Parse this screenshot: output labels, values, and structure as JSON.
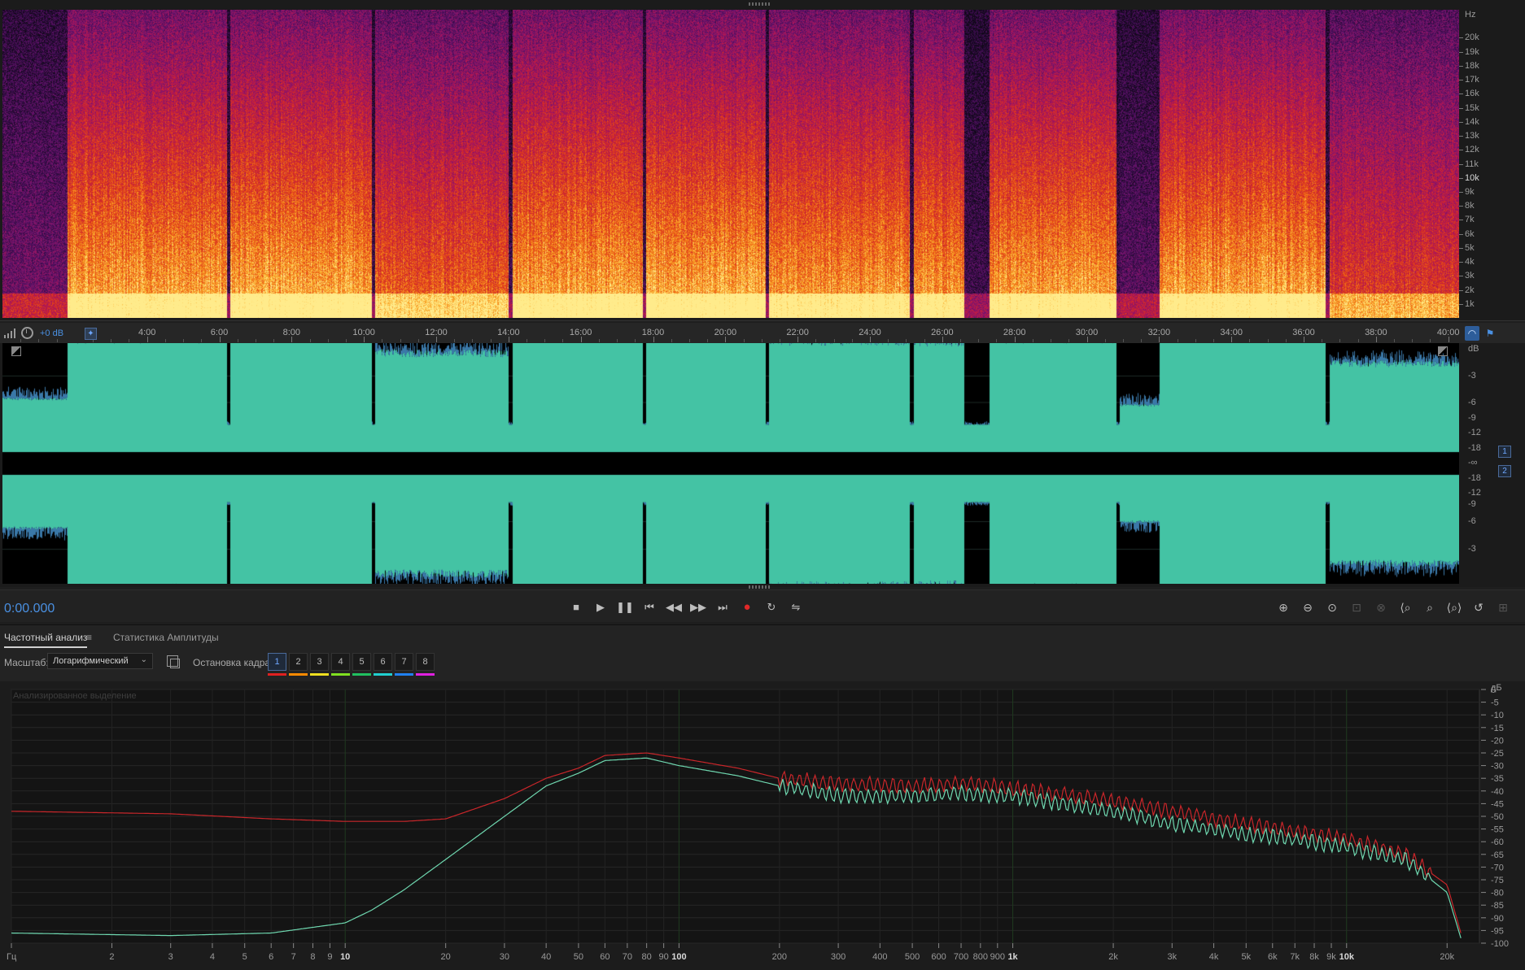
{
  "spectrogram": {
    "unit": "Hz",
    "freq_labels": [
      {
        "label": "20k",
        "hz": 20000
      },
      {
        "label": "19k",
        "hz": 19000
      },
      {
        "label": "18k",
        "hz": 18000
      },
      {
        "label": "17k",
        "hz": 17000
      },
      {
        "label": "16k",
        "hz": 16000
      },
      {
        "label": "15k",
        "hz": 15000
      },
      {
        "label": "14k",
        "hz": 14000
      },
      {
        "label": "13k",
        "hz": 13000
      },
      {
        "label": "12k",
        "hz": 12000
      },
      {
        "label": "11k",
        "hz": 11000
      },
      {
        "label": "10k",
        "hz": 10000
      },
      {
        "label": "9k",
        "hz": 9000
      },
      {
        "label": "8k",
        "hz": 8000
      },
      {
        "label": "7k",
        "hz": 7000
      },
      {
        "label": "6k",
        "hz": 6000
      },
      {
        "label": "5k",
        "hz": 5000
      },
      {
        "label": "4k",
        "hz": 4000
      },
      {
        "label": "3k",
        "hz": 3000
      },
      {
        "label": "2k",
        "hz": 2000
      },
      {
        "label": "1k",
        "hz": 1000
      }
    ],
    "max_hz": 22000
  },
  "timeline": {
    "gain": "+0 dB",
    "total_minutes": 40.3,
    "labels": [
      "4:00",
      "6:00",
      "8:00",
      "10:00",
      "12:00",
      "14:00",
      "16:00",
      "18:00",
      "20:00",
      "22:00",
      "24:00",
      "26:00",
      "28:00",
      "30:00",
      "32:00",
      "34:00",
      "36:00",
      "38:00",
      "40:00"
    ],
    "segments": [
      {
        "start": 0.0,
        "end": 1.8,
        "level": 0.28
      },
      {
        "start": 1.8,
        "end": 6.2,
        "level": 0.86
      },
      {
        "start": 6.3,
        "end": 10.2,
        "level": 0.88
      },
      {
        "start": 10.3,
        "end": 14.0,
        "level": 0.72
      },
      {
        "start": 14.1,
        "end": 17.7,
        "level": 0.87
      },
      {
        "start": 17.8,
        "end": 21.1,
        "level": 0.88
      },
      {
        "start": 21.2,
        "end": 25.1,
        "level": 0.84
      },
      {
        "start": 25.2,
        "end": 26.6,
        "level": 0.83
      },
      {
        "start": 27.3,
        "end": 30.8,
        "level": 0.86
      },
      {
        "start": 30.9,
        "end": 32.0,
        "level": 0.22
      },
      {
        "start": 32.0,
        "end": 36.6,
        "level": 0.87
      },
      {
        "start": 36.7,
        "end": 40.3,
        "level": 0.62
      }
    ]
  },
  "waveform": {
    "db_labels": [
      {
        "label": "dB",
        "pos": 0.025
      },
      {
        "label": "-3",
        "pos": 0.135
      },
      {
        "label": "-6",
        "pos": 0.245
      },
      {
        "label": "-9",
        "pos": 0.31
      },
      {
        "label": "-12",
        "pos": 0.37
      },
      {
        "label": "-18",
        "pos": 0.435
      },
      {
        "label": "-∞",
        "pos": 0.495
      },
      {
        "label": "-18",
        "pos": 0.56
      },
      {
        "label": "-12",
        "pos": 0.62
      },
      {
        "label": "-9",
        "pos": 0.67
      },
      {
        "label": "-6",
        "pos": 0.74
      },
      {
        "label": "-3",
        "pos": 0.855
      }
    ],
    "channels": [
      "1",
      "2"
    ]
  },
  "transport": {
    "time": "0:00.000",
    "buttons": [
      "stop-icon",
      "play-icon",
      "pause-icon",
      "go-to-start-icon",
      "rewind-icon",
      "fast-forward-icon",
      "go-to-end-icon",
      "record-icon",
      "loop-icon",
      "skip-selection-icon"
    ],
    "zoom_buttons": [
      "zoom-in-amplitude-icon",
      "zoom-out-amplitude-icon",
      "zoom-reset-icon",
      "zoom-selection-icon",
      "zoom-left-icon",
      "zoom-in-time-icon",
      "zoom-out-time-icon",
      "zoom-full-icon",
      "zoom-restore-icon",
      "zoom-fit-icon"
    ]
  },
  "panel": {
    "tab_frequency": "Частотный анализ",
    "tab_amplitude": "Статистика Амплитуды",
    "scale_label": "Масштаб:",
    "scale_value": "Логарифмический",
    "hold_label": "Остановка кадра:",
    "hold_buttons": [
      {
        "label": "1",
        "color": "#e02020"
      },
      {
        "label": "2",
        "color": "#ff8a00"
      },
      {
        "label": "3",
        "color": "#f0e020"
      },
      {
        "label": "4",
        "color": "#80e020"
      },
      {
        "label": "5",
        "color": "#20c060"
      },
      {
        "label": "6",
        "color": "#20d0d0"
      },
      {
        "label": "7",
        "color": "#2080f0"
      },
      {
        "label": "8",
        "color": "#e020e0"
      }
    ]
  },
  "chart_data": {
    "type": "line",
    "title": "Анализированное выделение",
    "xlabel": "Гц",
    "ylabel": "дБ",
    "x_scale": "log",
    "xlim": [
      1,
      25000
    ],
    "ylim": [
      -100,
      0
    ],
    "x_ticks": [
      {
        "label": "Гц",
        "hz": 1
      },
      {
        "label": "2",
        "hz": 2
      },
      {
        "label": "3",
        "hz": 3
      },
      {
        "label": "4",
        "hz": 4
      },
      {
        "label": "5",
        "hz": 5
      },
      {
        "label": "6",
        "hz": 6
      },
      {
        "label": "7",
        "hz": 7
      },
      {
        "label": "8",
        "hz": 8
      },
      {
        "label": "9",
        "hz": 9
      },
      {
        "label": "10",
        "hz": 10
      },
      {
        "label": "20",
        "hz": 20
      },
      {
        "label": "30",
        "hz": 30
      },
      {
        "label": "40",
        "hz": 40
      },
      {
        "label": "50",
        "hz": 50
      },
      {
        "label": "60",
        "hz": 60
      },
      {
        "label": "70",
        "hz": 70
      },
      {
        "label": "80",
        "hz": 80
      },
      {
        "label": "90",
        "hz": 90
      },
      {
        "label": "100",
        "hz": 100
      },
      {
        "label": "200",
        "hz": 200
      },
      {
        "label": "300",
        "hz": 300
      },
      {
        "label": "400",
        "hz": 400
      },
      {
        "label": "500",
        "hz": 500
      },
      {
        "label": "600",
        "hz": 600
      },
      {
        "label": "700",
        "hz": 700
      },
      {
        "label": "800",
        "hz": 800
      },
      {
        "label": "900",
        "hz": 900
      },
      {
        "label": "1k",
        "hz": 1000
      },
      {
        "label": "2k",
        "hz": 2000
      },
      {
        "label": "3k",
        "hz": 3000
      },
      {
        "label": "4k",
        "hz": 4000
      },
      {
        "label": "5k",
        "hz": 5000
      },
      {
        "label": "6k",
        "hz": 6000
      },
      {
        "label": "7k",
        "hz": 7000
      },
      {
        "label": "8k",
        "hz": 8000
      },
      {
        "label": "9k",
        "hz": 9000
      },
      {
        "label": "10k",
        "hz": 10000
      },
      {
        "label": "20k",
        "hz": 20000
      }
    ],
    "y_ticks": [
      0,
      -5,
      -10,
      -15,
      -20,
      -25,
      -30,
      -35,
      -40,
      -45,
      -50,
      -55,
      -60,
      -65,
      -70,
      -75,
      -80,
      -85,
      -90,
      -95,
      -100
    ],
    "series": [
      {
        "color": "#c8262a",
        "x": [
          1,
          3,
          6,
          10,
          15,
          20,
          30,
          40,
          50,
          60,
          80,
          100,
          150,
          200,
          300,
          500,
          700,
          1000,
          2000,
          3000,
          5000,
          7000,
          10000,
          15000,
          20000,
          22000
        ],
        "y": [
          -48,
          -49,
          -51,
          -52,
          -52,
          -51,
          -43,
          -35,
          -31,
          -26,
          -25,
          -27,
          -31,
          -35,
          -37,
          -38,
          -37,
          -39,
          -44,
          -48,
          -53,
          -56,
          -59,
          -65,
          -77,
          -96
        ]
      },
      {
        "color": "#6fd8b0",
        "x": [
          1,
          3,
          6,
          10,
          12,
          15,
          20,
          30,
          40,
          50,
          60,
          80,
          100,
          150,
          200,
          300,
          500,
          700,
          1000,
          2000,
          3000,
          5000,
          7000,
          10000,
          15000,
          20000,
          22000
        ],
        "y": [
          -96,
          -97,
          -96,
          -92,
          -87,
          -79,
          -67,
          -50,
          -38,
          -33,
          -28,
          -27,
          -30,
          -34,
          -38,
          -42,
          -42,
          -41,
          -42,
          -48,
          -53,
          -57,
          -59,
          -62,
          -67,
          -80,
          -98
        ]
      }
    ]
  }
}
